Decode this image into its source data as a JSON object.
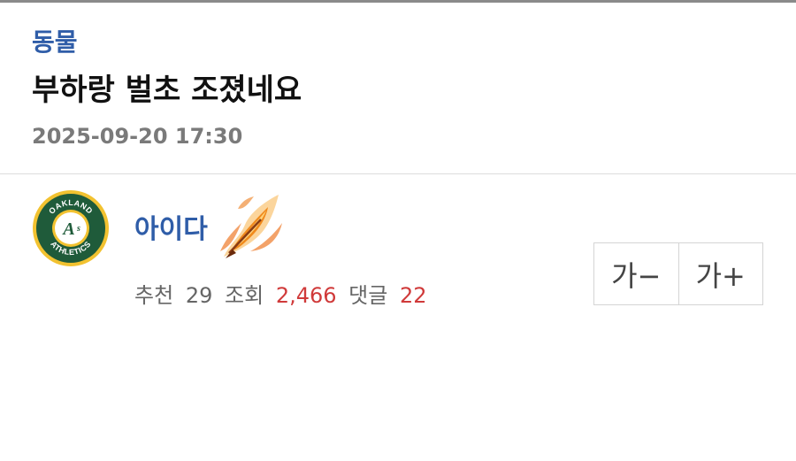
{
  "post": {
    "category": "동물",
    "title": "부하랑 벌초 조졌네요",
    "datetime": "2025-09-20 17:30"
  },
  "author": {
    "nickname": "아이다",
    "avatar_icon": "oakland-athletics-logo",
    "avatar_text_top": "OAKLAND",
    "avatar_text_bottom": "ATHLETICS",
    "badge_icon": "flaming-feather-icon"
  },
  "stats": {
    "recommend_label": "추천",
    "recommend_value": "29",
    "views_label": "조회",
    "views_value": "2,466",
    "comments_label": "댓글",
    "comments_value": "22"
  },
  "font_controls": {
    "decrease_label": "가−",
    "increase_label": "가+"
  },
  "colors": {
    "accent_blue": "#2f5da8",
    "number_red": "#d03a3a",
    "meta_gray": "#7a7a7a",
    "logo_green": "#1f5b3a",
    "logo_gold": "#f2c230"
  }
}
